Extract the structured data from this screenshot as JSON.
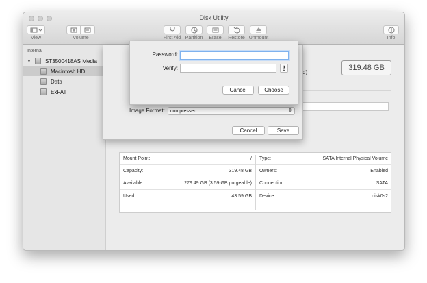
{
  "window": {
    "title": "Disk Utility"
  },
  "toolbar": {
    "view_label": "View",
    "volume_label": "Volume",
    "first_aid_label": "First Aid",
    "partition_label": "Partition",
    "erase_label": "Erase",
    "restore_label": "Restore",
    "unmount_label": "Unmount",
    "info_label": "Info"
  },
  "sidebar": {
    "header": "Internal",
    "disk": "ST3500418AS Media",
    "volumes": [
      "Macintosh HD",
      "Data",
      "ExFAT"
    ]
  },
  "main": {
    "capacity_badge": "319.48 GB",
    "paren_fragment": "d)"
  },
  "info": {
    "left": [
      {
        "label": "Mount Point:",
        "value": "/"
      },
      {
        "label": "Capacity:",
        "value": "319.48 GB"
      },
      {
        "label": "Available:",
        "value": "279.49 GB (3.59 GB purgeable)"
      },
      {
        "label": "Used:",
        "value": "43.59 GB"
      }
    ],
    "right": [
      {
        "label": "Type:",
        "value": "SATA Internal Physical Volume"
      },
      {
        "label": "Owners:",
        "value": "Enabled"
      },
      {
        "label": "Connection:",
        "value": "SATA"
      },
      {
        "label": "Device:",
        "value": "disk0s2"
      }
    ]
  },
  "save_sheet": {
    "image_format_label": "Image Format:",
    "image_format_value": "compressed",
    "cancel_label": "Cancel",
    "save_label": "Save"
  },
  "password_sheet": {
    "password_label": "Password:",
    "verify_label": "Verify:",
    "password_value": "",
    "verify_value": "",
    "key_icon_glyph": "⚷",
    "cancel_label": "Cancel",
    "choose_label": "Choose"
  },
  "colors": {
    "accent": "#3f9cf3",
    "focus_ring": "#7fb2ee"
  }
}
